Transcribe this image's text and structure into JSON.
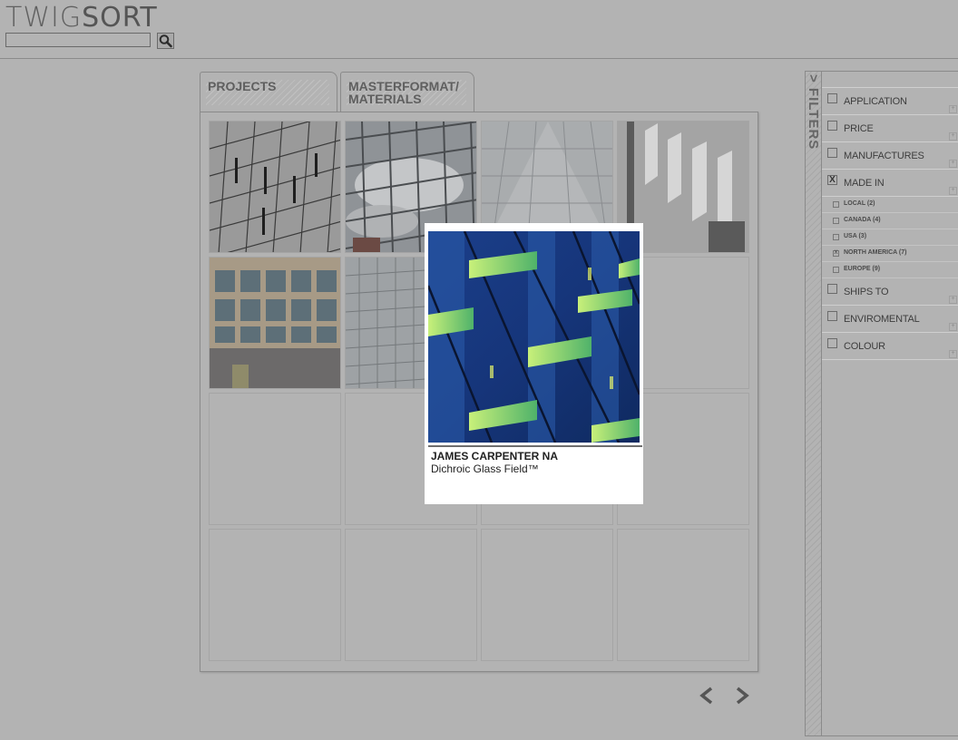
{
  "logo": {
    "part1": "TWIG",
    "part2": "SORT"
  },
  "search": {
    "value": "",
    "icon": "search-icon"
  },
  "tabs": [
    {
      "label": "PROJECTS"
    },
    {
      "label_line1": "MASTERFORMAT/",
      "label_line2": "MATERIALS"
    }
  ],
  "popup": {
    "manufacturer": "JAMES CARPENTER NA",
    "product": "Dichroic Glass Field™"
  },
  "pager": {
    "prev_icon": "chevron-left-icon",
    "next_icon": "chevron-right-icon"
  },
  "filters": {
    "toggle_label": "> FILTERS",
    "categories": [
      {
        "label": "APPLICATION",
        "checked": false
      },
      {
        "label": "PRICE",
        "checked": false
      },
      {
        "label": "MANUFACTURES",
        "checked": false
      },
      {
        "label": "MADE IN",
        "checked": true
      },
      {
        "label": "SHIPS TO",
        "checked": false
      },
      {
        "label": "ENVIROMENTAL",
        "checked": false
      },
      {
        "label": "COLOUR",
        "checked": false
      }
    ],
    "made_in_options": [
      {
        "label": "LOCAL (2)",
        "checked": false
      },
      {
        "label": "CANADA (4)",
        "checked": false
      },
      {
        "label": "USA (3)",
        "checked": false
      },
      {
        "label": "NORTH AMERICA (7)",
        "checked": true
      },
      {
        "label": "EUROPE (9)",
        "checked": false
      }
    ],
    "check_mark": "X"
  }
}
